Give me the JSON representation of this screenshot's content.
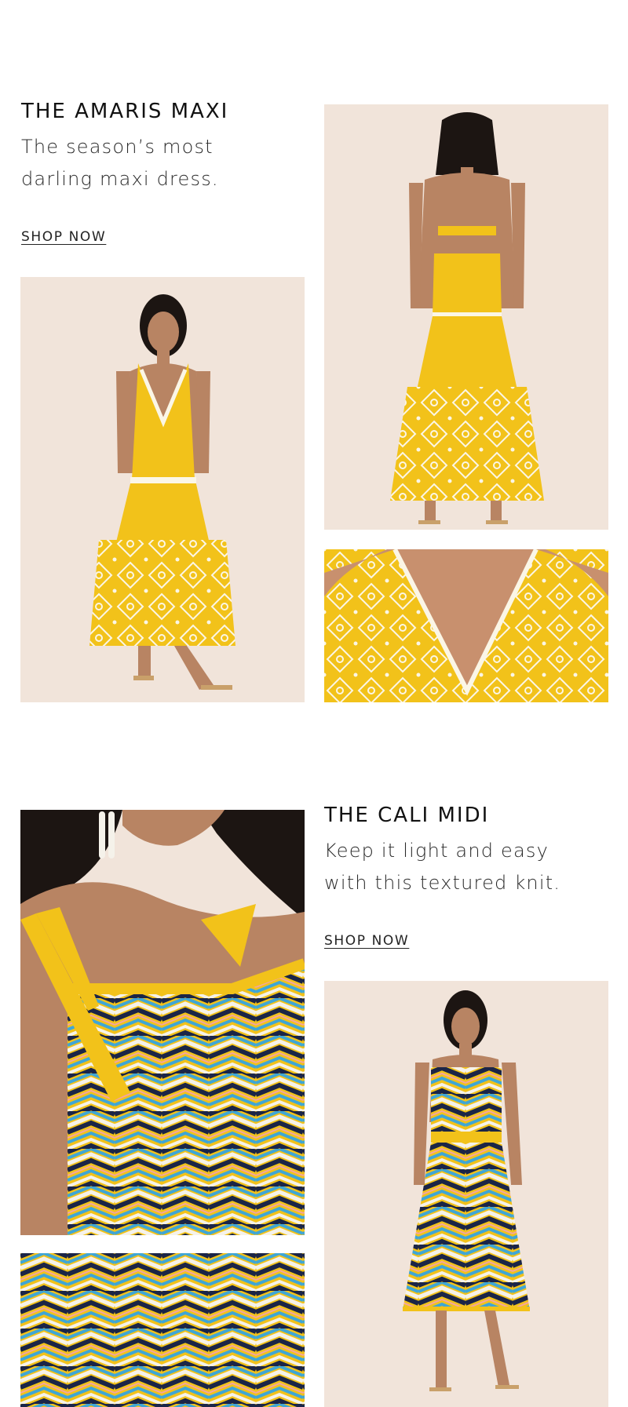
{
  "sections": [
    {
      "title": "THE AMARIS MAXI",
      "subtitle_line1": "The season’s most",
      "subtitle_line2": "darling maxi dress.",
      "cta": "SHOP NOW"
    },
    {
      "title": "THE CALI MIDI",
      "subtitle_line1": "Keep it light and easy",
      "subtitle_line2": "with this textured knit.",
      "cta": "SHOP NOW"
    }
  ],
  "colors": {
    "background": "#ffffff",
    "photo_backdrop": "#f1e4da",
    "dress_yellow": "#f2c21a",
    "embroidery_white": "#fbf6e6",
    "knit_navy": "#1b2547",
    "knit_blue": "#3fa6d6",
    "skin": "#b88463",
    "hair": "#1c1512"
  }
}
